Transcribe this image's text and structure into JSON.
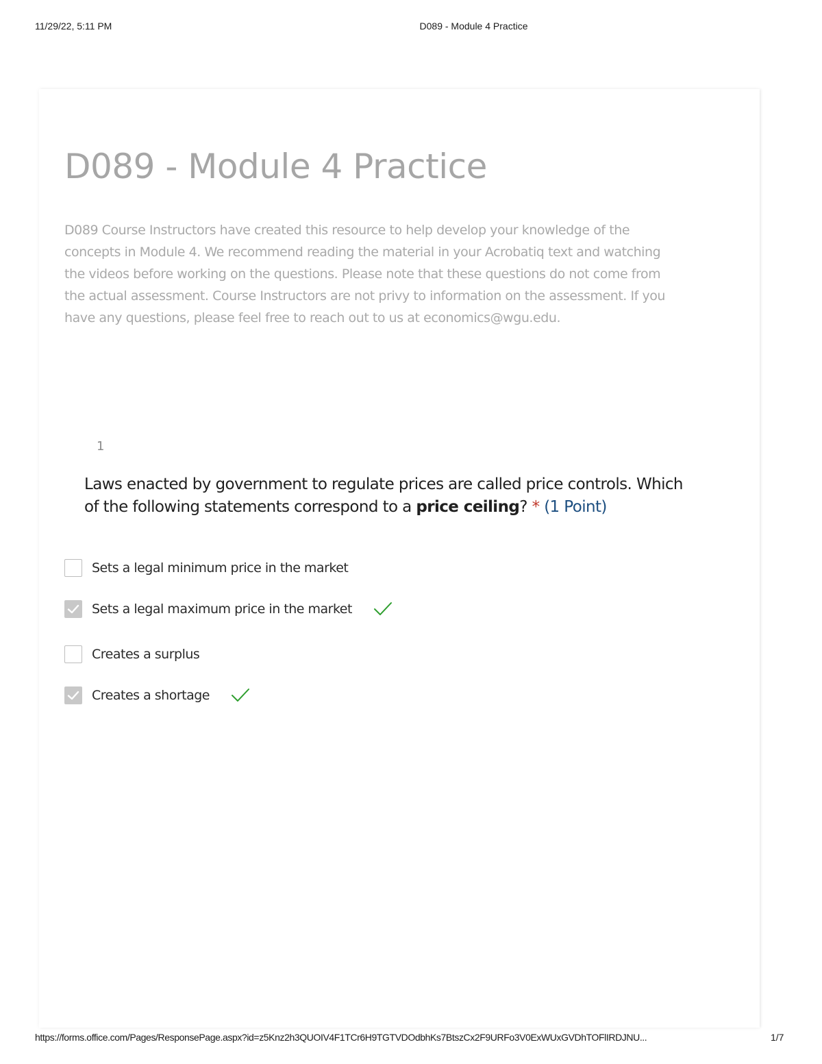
{
  "print_header": {
    "datetime": "11/29/22, 5:11 PM",
    "title": "D089 - Module 4 Practice"
  },
  "form": {
    "title": "D089 - Module 4 Practice",
    "description_lines": [
      "D089 Course Instructors have created this resource to help develop your knowledge of the",
      "concepts in Module 4. We recommend reading the material in your Acrobatiq text and watching",
      "the videos before working on the questions.  Please note that these questions do not come from",
      "the actual assessment. Course Instructors are not privy to information on the assessment.   If you",
      "have any questions, please feel free to reach out to us at economics@wgu.edu."
    ]
  },
  "question": {
    "number": "1",
    "text_part1": "Laws enacted by government to regulate prices are called price controls. Which of the following statements correspond to a ",
    "text_bold": "price ceiling",
    "text_part2": "? ",
    "required_mark": "*",
    "points": "(1 Point)",
    "options": [
      {
        "label": "Sets a legal minimum price in the market",
        "checked": false,
        "correct_mark": false
      },
      {
        "label": "Sets a legal maximum price in the market",
        "checked": true,
        "correct_mark": true
      },
      {
        "label": "Creates a surplus",
        "checked": false,
        "correct_mark": false
      },
      {
        "label": "Creates a shortage",
        "checked": true,
        "correct_mark": true
      }
    ]
  },
  "colors": {
    "correct_mark": "#2e9e2e",
    "required_star": "#c0392b",
    "points": "#1c4e80"
  },
  "icons": {
    "correct": "checkmark-icon",
    "checkbox_checked": "checkbox-checked-icon"
  },
  "print_footer": {
    "url": "https://forms.office.com/Pages/ResponsePage.aspx?id=z5Knz2h3QUOIV4F1TCr6H9TGTVDOdbhKs7BtszCx2F9URFo3V0ExWUxGVDhTOFlIRDJNU...",
    "page": "1/7"
  }
}
